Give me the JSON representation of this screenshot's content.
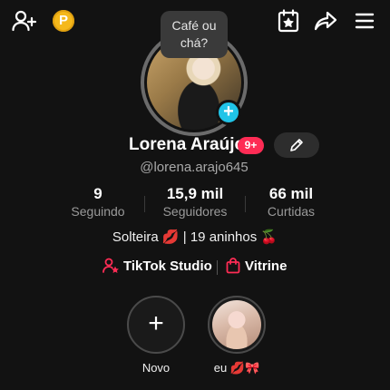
{
  "topbar": {
    "add_friend_icon": "add-user-icon",
    "coin_label": "P",
    "calendar_icon": "calendar-star-icon",
    "share_icon": "share-arrow-icon",
    "menu_icon": "hamburger-menu-icon"
  },
  "note_bubble": {
    "line1": "Café ou",
    "line2": "chá?"
  },
  "profile": {
    "name": "Lorena Araújo",
    "notif_badge": "9+",
    "handle": "@lorena.arajo645",
    "stats": [
      {
        "value": "9",
        "label": "Seguindo"
      },
      {
        "value": "15,9 mil",
        "label": "Seguidores"
      },
      {
        "value": "66 mil",
        "label": "Curtidas"
      }
    ],
    "bio": "Solteira 💋 | 19 aninhos 🍒"
  },
  "links": {
    "studio": "TikTok Studio",
    "vitrine": "Vitrine"
  },
  "highlights": [
    {
      "label": "Novo"
    },
    {
      "label": "eu 💋🎀"
    }
  ],
  "colors": {
    "background": "#121212",
    "accent_red": "#fe2c55",
    "plus_badge": "#20c4e8",
    "coin": "#f5b81b"
  }
}
